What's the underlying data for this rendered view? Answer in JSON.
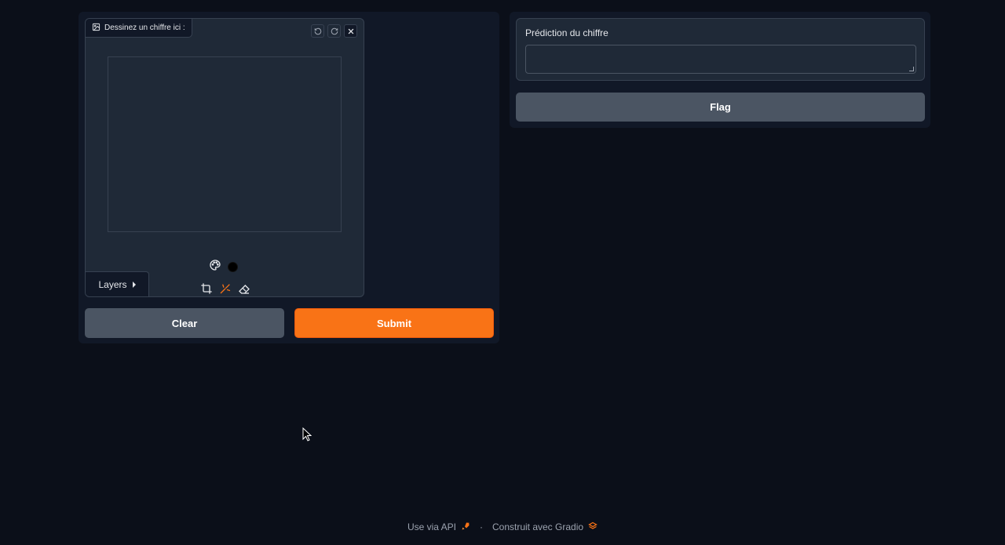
{
  "sketch": {
    "label": "Dessinez un chiffre ici :",
    "layers_label": "Layers",
    "brush_color": "#000000"
  },
  "buttons": {
    "clear": "Clear",
    "submit": "Submit",
    "flag": "Flag"
  },
  "prediction": {
    "label": "Prédiction du chiffre",
    "value": ""
  },
  "footer": {
    "api_link": "Use via API",
    "separator": "·",
    "built_with": "Construit avec Gradio"
  },
  "colors": {
    "accent": "#f97316",
    "background": "#0b0f19",
    "panel": "#1f2937"
  }
}
